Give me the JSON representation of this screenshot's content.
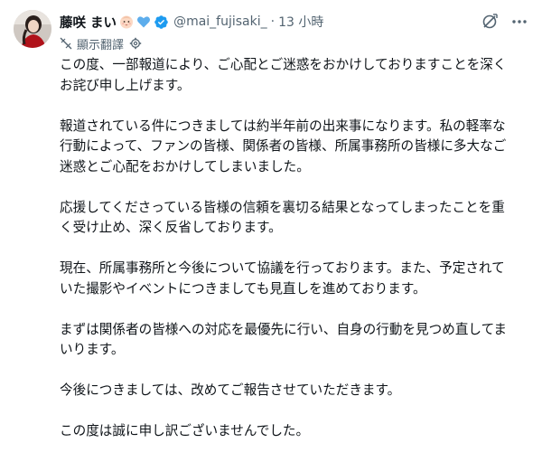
{
  "author": {
    "display_name": "藤咲 まい",
    "handle": "@mai_fujisaki_",
    "timestamp": "13 小時",
    "separator": "·",
    "emoji_badges": [
      "baby-face-emoji",
      "blue-heart-emoji"
    ],
    "verified_icon": "verified-badge-icon",
    "avatar": "avatar"
  },
  "actions": {
    "grok_icon": "grok-icon",
    "more_icon": "more-options-icon"
  },
  "translate": {
    "label": "顯示翻譯",
    "icon": "translate-icon",
    "settings_icon": "gear-icon"
  },
  "colors": {
    "text_primary": "#0f1419",
    "text_secondary": "#536471",
    "verified_blue": "#1d9bf0",
    "heart_blue": "#5dadec"
  },
  "body": {
    "paragraphs": [
      "この度、一部報道により、ご心配とご迷惑をおかけしておりますことを深く\nお詫び申し上げます。",
      "報道されている件につきましては約半年前の出来事になります。私の軽率な\n行動によって、ファンの皆様、関係者の皆様、所属事務所の皆様に多大なご\n迷惑とご心配をおかけしてしまいました。",
      "応援してくださっている皆様の信頼を裏切る結果となってしまったことを重\nく受け止め、深く反省しております。",
      "現在、所属事務所と今後について協議を行っております。また、予定されて\nいた撮影やイベントにつきましても見直しを進めております。",
      "まずは関係者の皆様への対応を最優先に行い、自身の行動を見つめ直してま\nいります。",
      "今後につきましては、改めてご報告させていただきます。",
      "この度は誠に申し訳ございませんでした。"
    ]
  }
}
